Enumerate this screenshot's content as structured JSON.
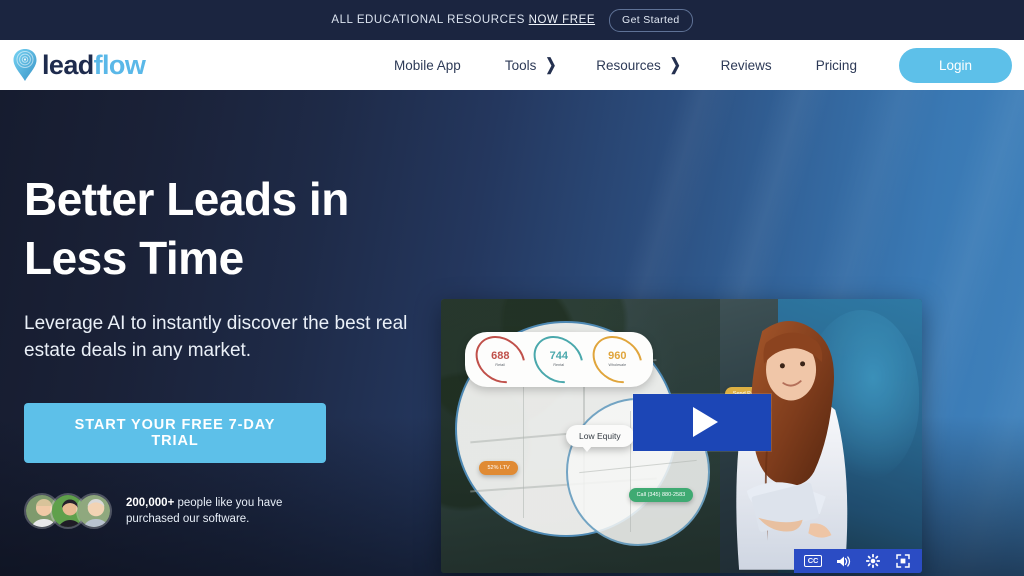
{
  "announcement": {
    "text_prefix": "ALL EDUCATIONAL RESOURCES ",
    "text_highlight": "NOW FREE",
    "button_label": "Get Started"
  },
  "brand": {
    "name_part1": "lead",
    "name_part2": "flow",
    "logo_icon": "map-pin-icon",
    "accent_color": "#5dc0e9",
    "dark_color": "#1e2b4d"
  },
  "nav": {
    "items": [
      {
        "label": "Mobile App",
        "has_dropdown": false
      },
      {
        "label": "Tools",
        "has_dropdown": true
      },
      {
        "label": "Resources",
        "has_dropdown": true
      },
      {
        "label": "Reviews",
        "has_dropdown": false
      },
      {
        "label": "Pricing",
        "has_dropdown": false
      }
    ],
    "login_label": "Login"
  },
  "hero": {
    "headline_line1": "Better Leads in",
    "headline_line2": "Less Time",
    "subheadline": "Leverage AI to instantly discover the best real estate deals in any market.",
    "cta_label": "START YOUR FREE 7-DAY TRIAL",
    "social_proof_count": "200,000+",
    "social_proof_text": " people like you have purchased our software."
  },
  "video": {
    "play_label": "play-button",
    "gauges": [
      {
        "value": "688",
        "label": "Retail",
        "color": "#c0504a"
      },
      {
        "value": "744",
        "label": "Rental",
        "color": "#4aa8ac"
      },
      {
        "value": "960",
        "label": "Wholesale",
        "color": "#e0a53c"
      }
    ],
    "map_pills": [
      {
        "label": "52% LTV",
        "color": "#e08a33"
      },
      {
        "label": "Send Postcard",
        "color": "#ddb043"
      },
      {
        "label": "Call (345) 880-2583",
        "color": "#3faa72"
      }
    ],
    "callout_label": "Low Equity",
    "controls": [
      {
        "name": "closed-captions",
        "glyph": "CC"
      },
      {
        "name": "volume",
        "glyph": "volume-icon"
      },
      {
        "name": "settings",
        "glyph": "gear-icon"
      },
      {
        "name": "fullscreen",
        "glyph": "fullscreen-icon"
      }
    ]
  }
}
